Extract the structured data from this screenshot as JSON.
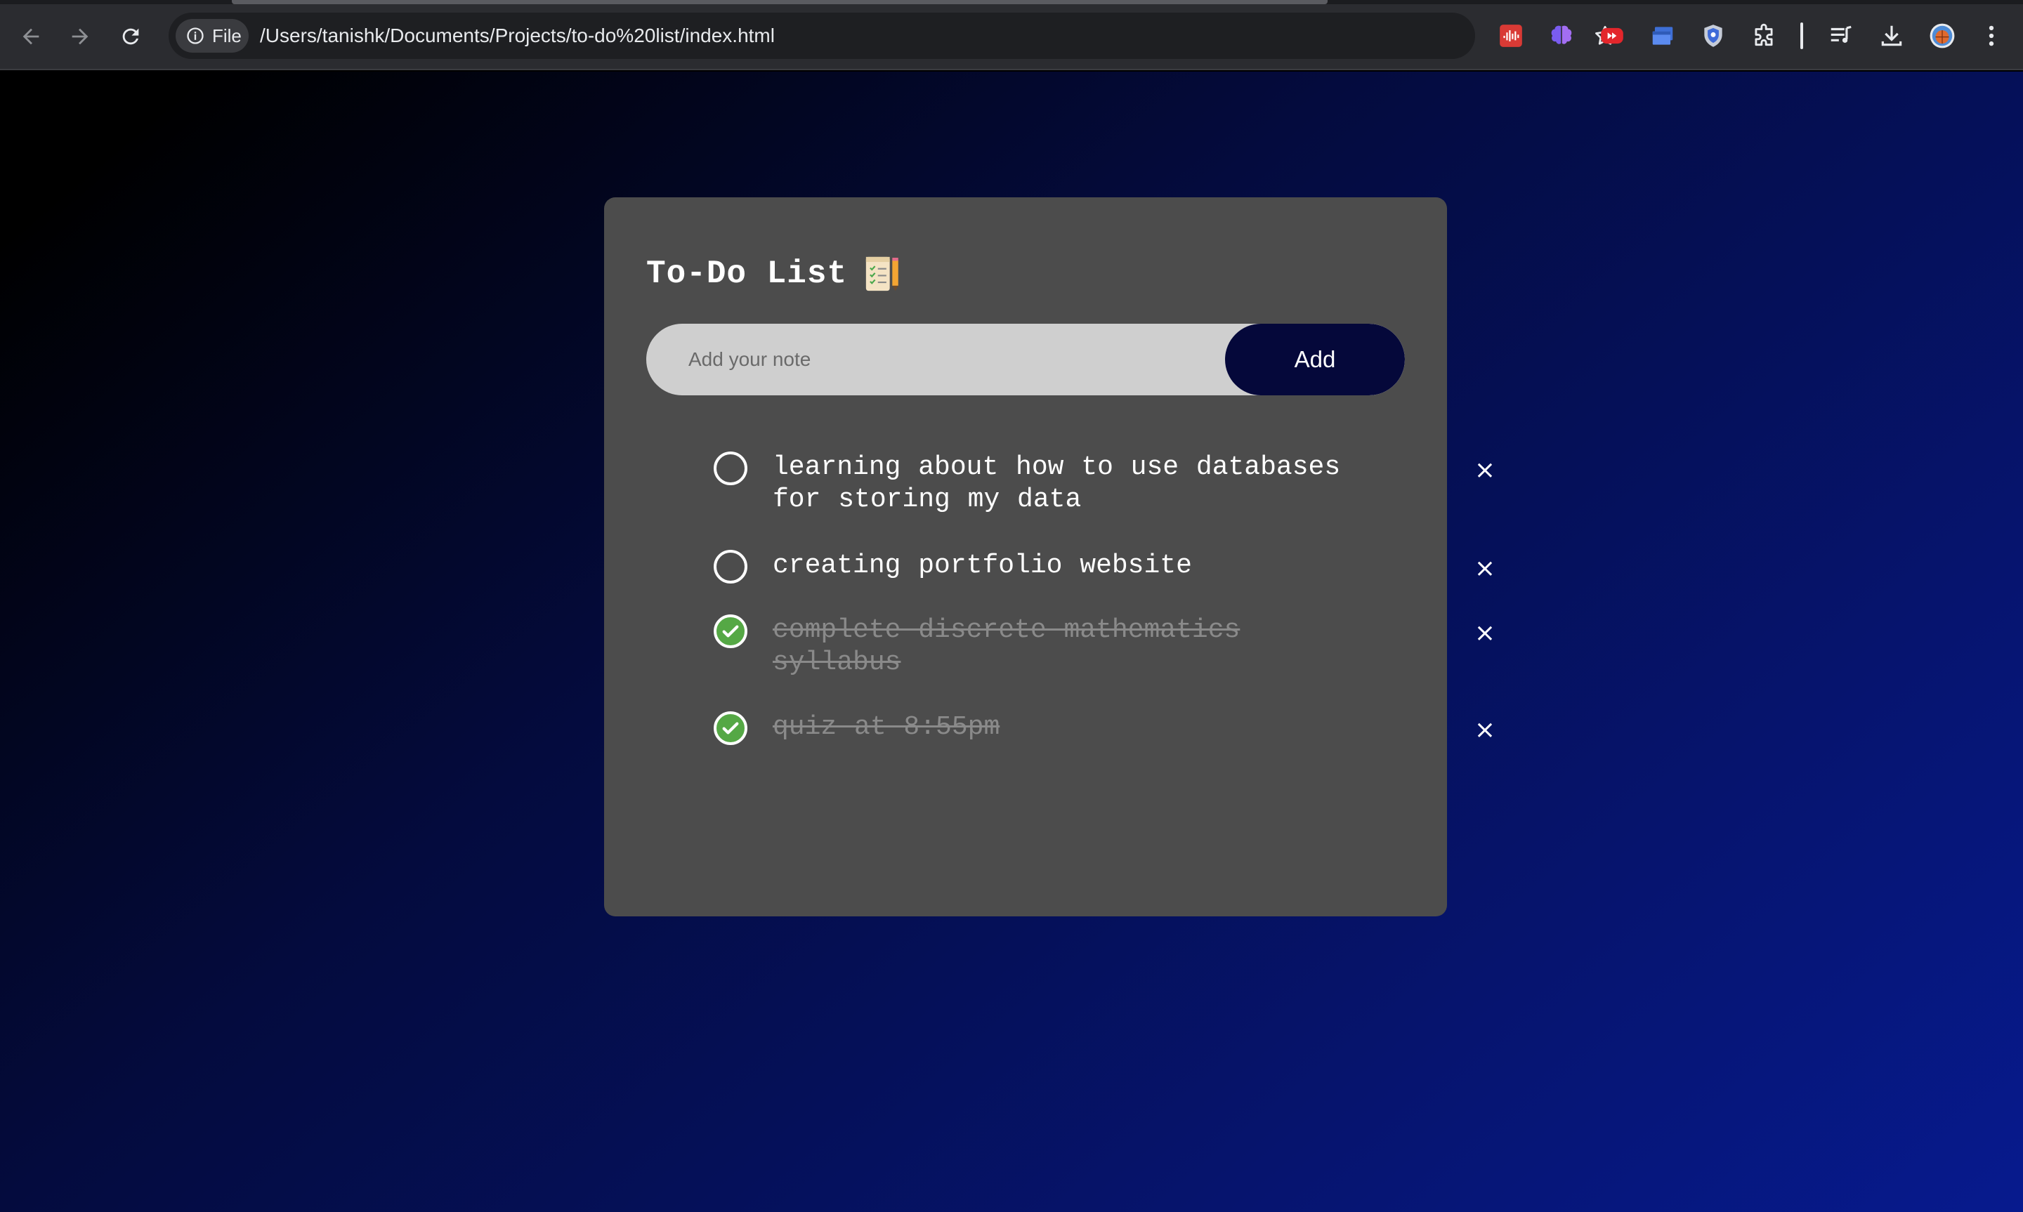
{
  "browser": {
    "site_chip_label": "File",
    "url": "/Users/tanishk/Documents/Projects/to-do%20list/index.html",
    "icons": [
      "back-arrow-icon",
      "forward-arrow-icon",
      "reload-icon",
      "info-icon",
      "star-icon",
      "audio-extension-icon",
      "brain-extension-icon",
      "youtube-extension-icon",
      "window-extension-icon",
      "shield-extension-icon",
      "puzzle-icon",
      "media-queue-icon",
      "download-icon",
      "profile-avatar",
      "kebab-menu-icon"
    ]
  },
  "app": {
    "title": "To-Do List",
    "title_icon": "notepad-checklist-icon",
    "input_placeholder": "Add your note",
    "add_label": "Add",
    "delete_glyph": "×",
    "tasks": [
      {
        "text": "learning about how to use databases for storing my data",
        "done": false
      },
      {
        "text": "creating portfolio website",
        "done": false
      },
      {
        "text": "complete discrete mathematics syllabus",
        "done": true
      },
      {
        "text": "quiz at 8:55pm",
        "done": true
      }
    ]
  },
  "colors": {
    "card_bg": "#4c4c4c",
    "add_button_bg": "#05083a",
    "check_done": "#55a845",
    "gradient_start": "#000000",
    "gradient_end": "#071a8e"
  }
}
